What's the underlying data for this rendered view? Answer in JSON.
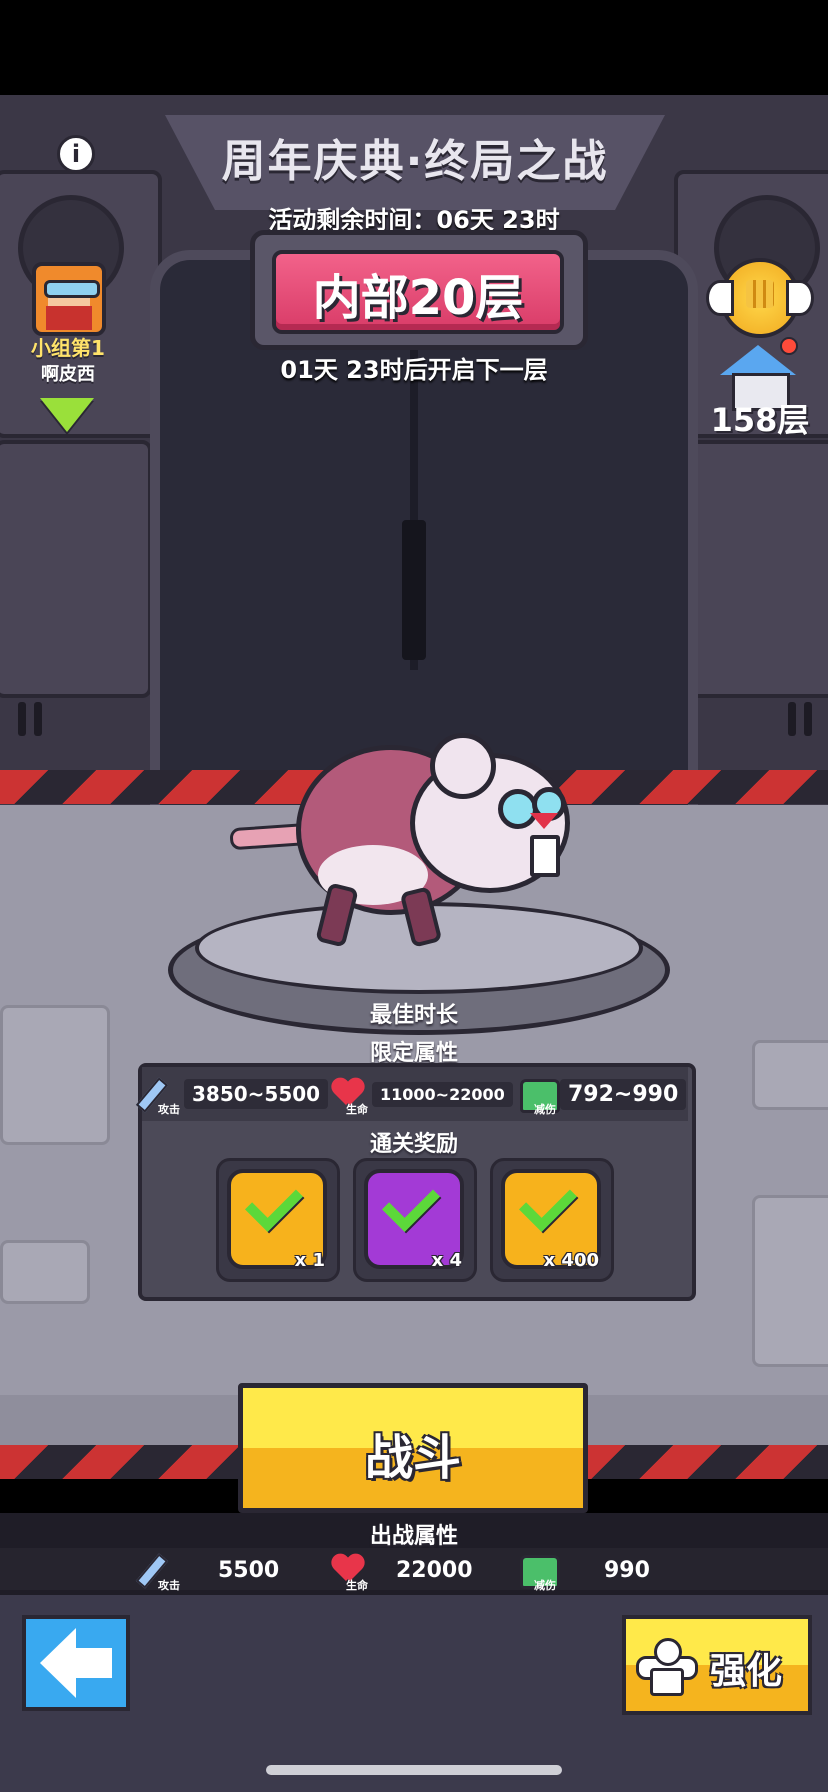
{
  "event": {
    "title": "周年庆典·终局之战",
    "remaining_time": "活动剩余时间：06天 23时",
    "current_floor": "内部20层",
    "next_floor_countdown": "01天 23时后开启下一层"
  },
  "player": {
    "rank": "小组第1",
    "name": "啊皮西"
  },
  "right_panel": {
    "floor": "158层"
  },
  "boss": {
    "best_time_label": "最佳时长",
    "limit_attr_label": "限定属性",
    "stats": [
      {
        "icon": "sword-icon",
        "caption": "攻击",
        "value": "3850~5500"
      },
      {
        "icon": "heart-icon",
        "caption": "生命",
        "value": "11000~22000"
      },
      {
        "icon": "armor-icon",
        "caption": "减伤",
        "value": "792~990"
      }
    ]
  },
  "rewards": {
    "title": "通关奖励",
    "items": [
      {
        "icon": "gun-icon",
        "qty": "x 1",
        "color": "#f7b21c"
      },
      {
        "icon": "hammer-icon",
        "qty": "x 4",
        "color": "#a33ad6"
      },
      {
        "icon": "coin-icon",
        "qty": "x 400",
        "color": "#f7b21c"
      }
    ]
  },
  "actions": {
    "fight": "战斗",
    "upgrade": "强化"
  },
  "battle_attrs": {
    "label": "出战属性",
    "stats": [
      {
        "icon": "sword-icon",
        "caption": "攻击",
        "value": "5500"
      },
      {
        "icon": "heart-icon",
        "caption": "生命",
        "value": "22000"
      },
      {
        "icon": "armor-icon",
        "caption": "减伤",
        "value": "990"
      }
    ]
  },
  "colors": {
    "accent_pink": "#e84a78",
    "button_yellow": "#f7c62a",
    "back_blue": "#39a9f0"
  }
}
